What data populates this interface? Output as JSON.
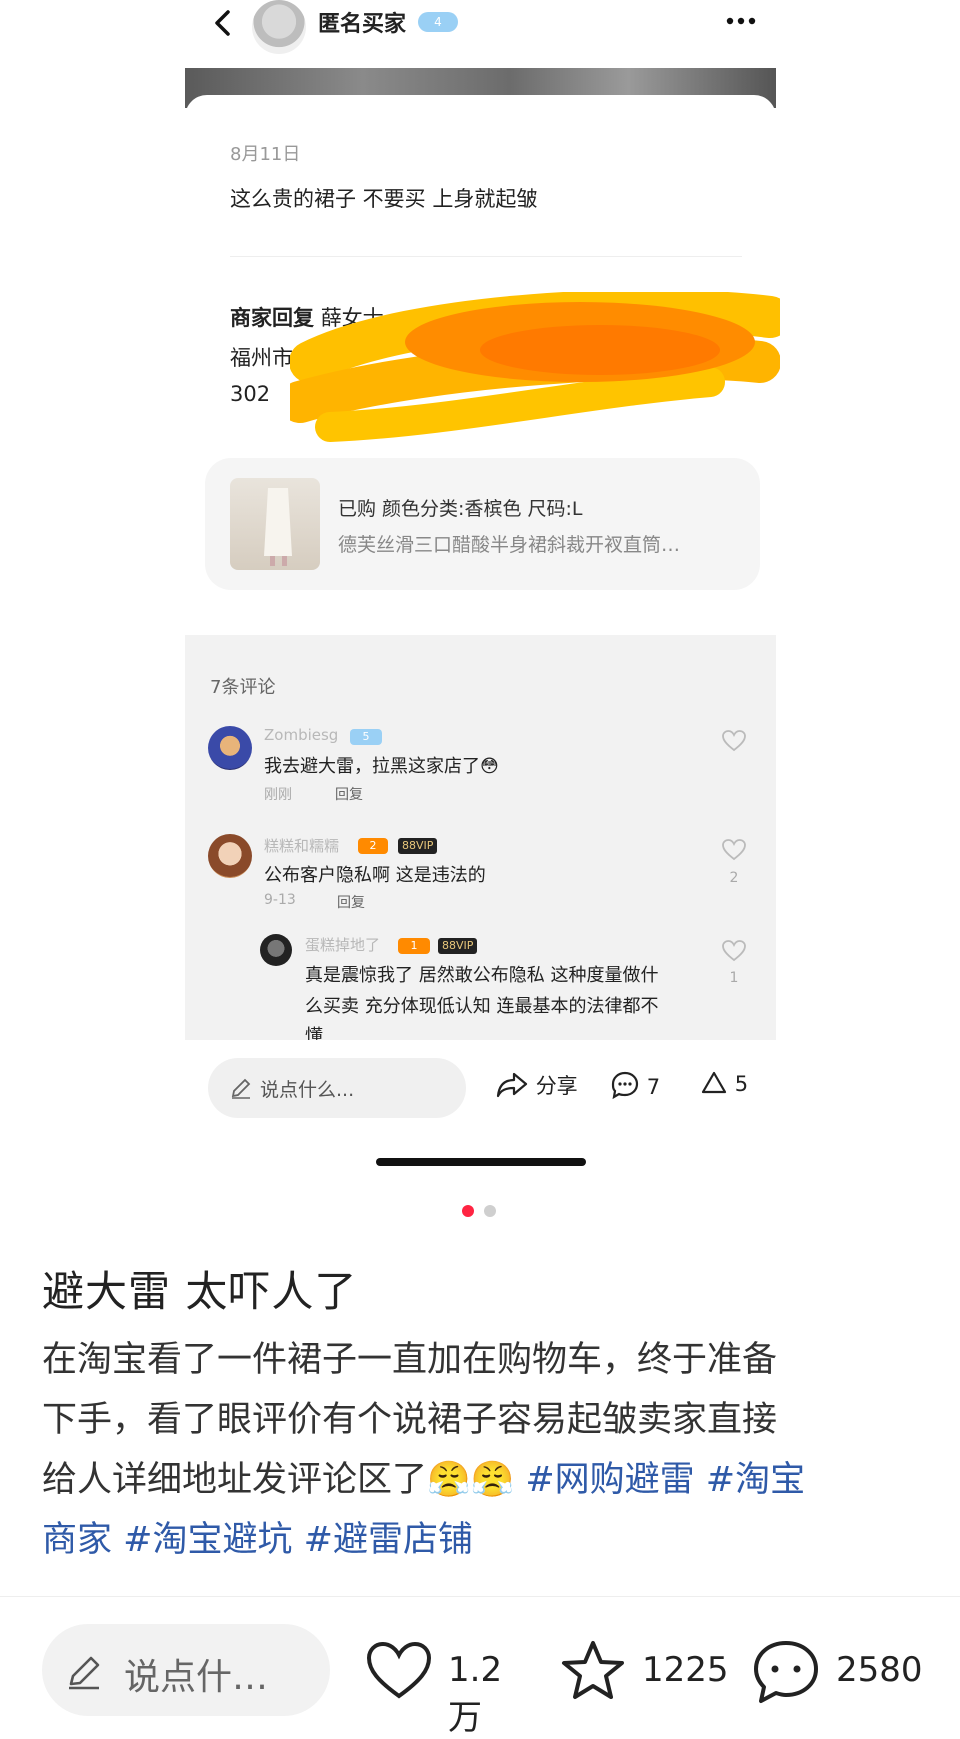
{
  "inner": {
    "buyer_name": "匿名买家",
    "buyer_level": "4",
    "back_icon": "chevron-left-icon",
    "more_icon": "more-dots-icon",
    "review_date": "8月11日",
    "review_text": "这么贵的裙子 不要买 上身就起皱",
    "merchant_label": "商家回复",
    "merchant_line1": "薛女士",
    "merchant_line2": "福州市",
    "merchant_line3": "302",
    "product": {
      "purchased": "已购 颜色分类:香槟色 尺码:L",
      "title": "德芙丝滑三口醋酸半身裙斜裁开衩直筒…"
    },
    "comments_count": "7条评论",
    "comments": [
      {
        "name": "Zombiesg",
        "level": "5",
        "text": "我去避大雷，拉黑这家店了😳",
        "time": "刚刚",
        "reply": "回复",
        "likes": ""
      },
      {
        "name": "糕糕和糯糯",
        "level": "2",
        "vip": "88VIP",
        "text": "公布客户隐私啊 这是违法的",
        "time": "9-13",
        "reply": "回复",
        "likes": "2"
      },
      {
        "name": "蛋糕掉地了",
        "level": "1",
        "vip": "88VIP",
        "text_l1": "真是震惊我了 居然敢公布隐私 这种度量做什",
        "text_l2": "么买卖 充分体现低认知 连最基本的法律都不",
        "text_l3": "懂",
        "likes": "1"
      }
    ],
    "bar": {
      "input_placeholder": "说点什么...",
      "share_label": "分享",
      "comment_count": "7",
      "like_count": "5"
    }
  },
  "post": {
    "title": "避大雷 太吓人了",
    "body_l1": "在淘宝看了一件裙子一直加在购物车，终于准备",
    "body_l2": "下手，看了眼评价有个说裙子容易起皱卖家直接",
    "body_l3": "给人详细地址发评论区了",
    "emoji": "😤😤",
    "tags": [
      "#网购避雷",
      "#淘宝商家",
      "#淘宝避坑",
      "#避雷店铺"
    ],
    "tag_line1_a": "#网购避雷",
    "tag_line1_b": "#淘宝",
    "tag_line2_a": "商家",
    "tag_line2_b": "#淘宝避坑",
    "tag_line2_c": "#避雷店铺",
    "page_dots": {
      "total": 2,
      "active": 1
    }
  },
  "bottom_bar": {
    "input_placeholder": "说点什…",
    "likes": "1.2万",
    "favorites": "1225",
    "comments": "2580"
  },
  "colors": {
    "accent_red": "#ff2442",
    "tag_blue": "#2f5aa8",
    "redaction_orange": "#ff8c00"
  }
}
